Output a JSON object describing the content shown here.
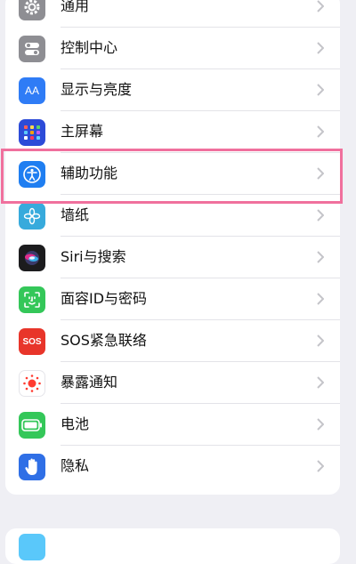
{
  "settings": {
    "rows": [
      {
        "label": "通用",
        "icon": "gear-icon",
        "color": "#8e8e93"
      },
      {
        "label": "控制中心",
        "icon": "control-center-icon",
        "color": "#8e8e93"
      },
      {
        "label": "显示与亮度",
        "icon": "display-brightness-icon",
        "icon_text": "AA",
        "color": "#2f7cf6"
      },
      {
        "label": "主屏幕",
        "icon": "home-screen-icon",
        "color": "#2c4bd8"
      },
      {
        "label": "辅助功能",
        "icon": "accessibility-icon",
        "color": "#1f7ef1"
      },
      {
        "label": "墙纸",
        "icon": "wallpaper-icon",
        "color": "#37aadc"
      },
      {
        "label": "Siri与搜索",
        "icon": "siri-icon",
        "color": "#1c1c1e"
      },
      {
        "label": "面容ID与密码",
        "icon": "face-id-icon",
        "color": "#34c759"
      },
      {
        "label": "SOS紧急联络",
        "icon": "sos-icon",
        "icon_text": "SOS",
        "color": "#e8352a"
      },
      {
        "label": "暴露通知",
        "icon": "exposure-notification-icon",
        "color": "#ffffff"
      },
      {
        "label": "电池",
        "icon": "battery-icon",
        "color": "#34c759"
      },
      {
        "label": "隐私",
        "icon": "privacy-hand-icon",
        "color": "#2f6fe6"
      }
    ]
  }
}
